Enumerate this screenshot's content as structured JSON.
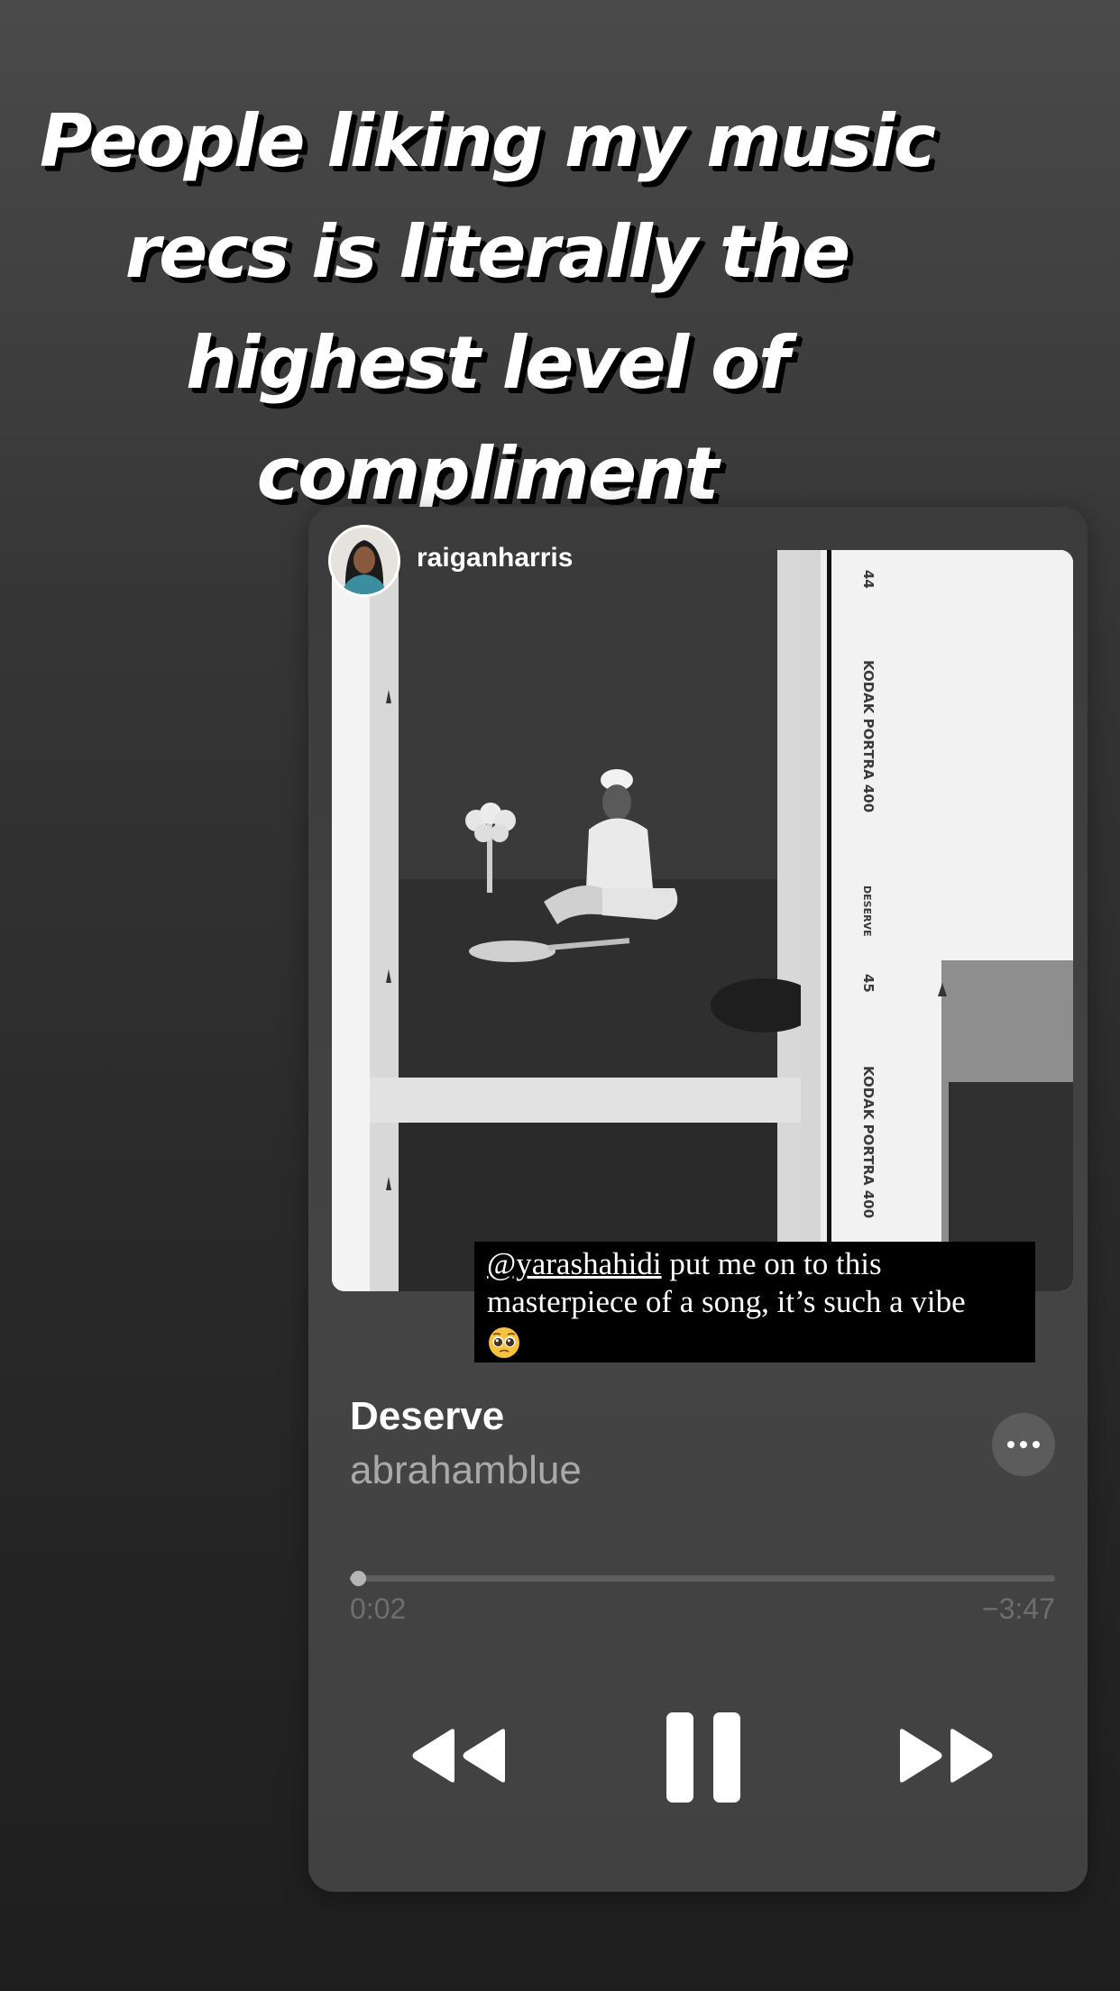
{
  "story": {
    "headline": "People liking my music recs is literally the highest level of compliment"
  },
  "post": {
    "username": "raiganharris",
    "caption": {
      "mention": "@yarashahidi",
      "text": " put me on to this masterpiece of a song, it’s such a vibe",
      "emoji_name": "pleading-face-emoji"
    },
    "artwork_labels": {
      "film_stock": "KODAK PORTRA 400",
      "film_title": "DESERVE",
      "frame_top": "44",
      "frame_mid": "45"
    }
  },
  "player": {
    "song_title": "Deserve",
    "artist": "abrahamblue",
    "progress_fraction": 0.009,
    "time_elapsed": "0:02",
    "time_remaining": "−3:47",
    "buttons": {
      "more": "ellipsis-icon",
      "rewind": "rewind-icon",
      "play_pause": "pause-icon",
      "forward": "fast-forward-icon"
    }
  },
  "colors": {
    "text_primary": "#ffffff",
    "text_secondary": "#a9a9a9",
    "time_text": "#6e6e6e",
    "card_background": "#3f3f3f"
  }
}
